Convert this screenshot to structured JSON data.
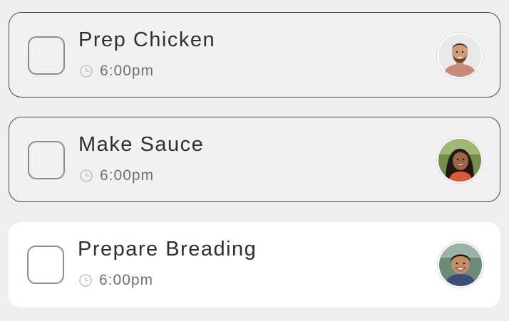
{
  "tasks": [
    {
      "title": "Prep Chicken",
      "time": "6:00pm",
      "checked": false,
      "avatar_icon": "avatar-man-beard"
    },
    {
      "title": "Make Sauce",
      "time": "6:00pm",
      "checked": false,
      "avatar_icon": "avatar-woman"
    },
    {
      "title": "Prepare Breading",
      "time": "6:00pm",
      "checked": false,
      "avatar_icon": "avatar-boy"
    }
  ],
  "colors": {
    "background": "#efefef",
    "card": "#f1f1f1",
    "card_active": "#ffffff",
    "text": "#2f2f2f",
    "muted": "#707070"
  }
}
